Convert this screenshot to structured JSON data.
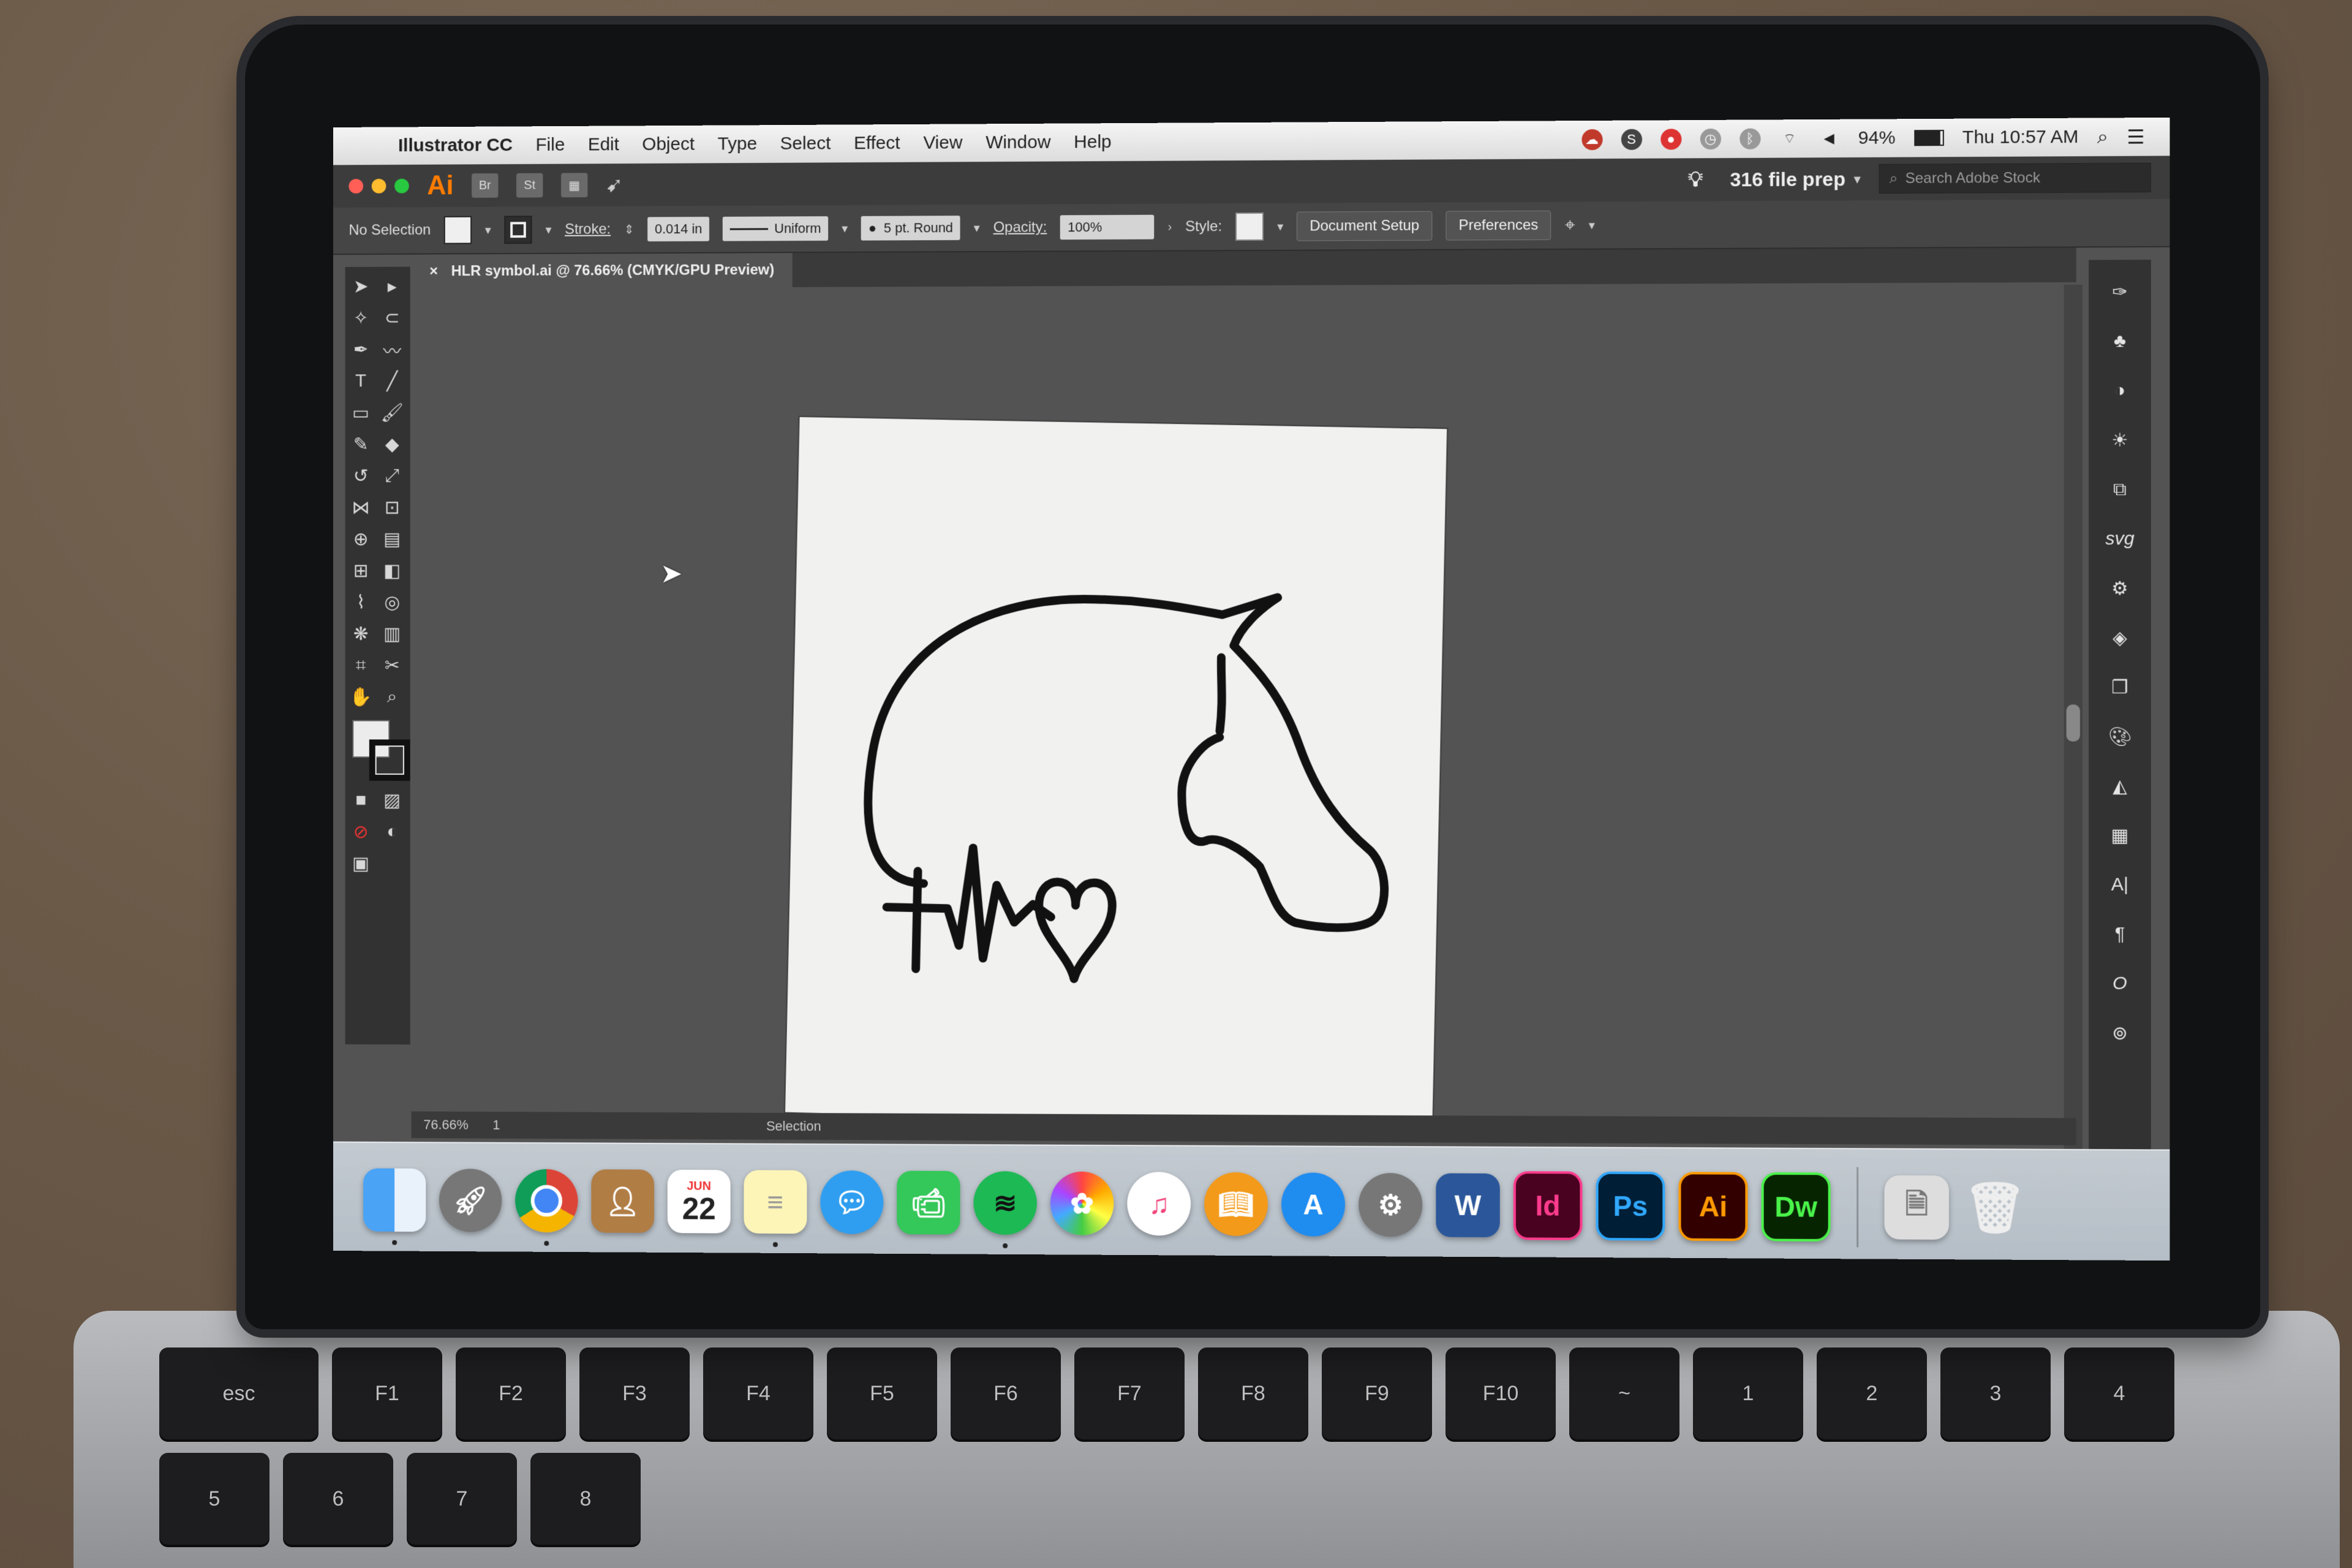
{
  "menubar": {
    "app_name": "Illustrator CC",
    "items": [
      "File",
      "Edit",
      "Object",
      "Type",
      "Select",
      "Effect",
      "View",
      "Window",
      "Help"
    ],
    "battery": "94%",
    "clock": "Thu 10:57 AM"
  },
  "appbar": {
    "logo": "Ai",
    "bridge": "Br",
    "stock": "St",
    "workspace": "316 file prep",
    "search_placeholder": "Search Adobe Stock"
  },
  "control_bar": {
    "selection": "No Selection",
    "stroke_label": "Stroke:",
    "stroke_value": "0.014 in",
    "profile": "Uniform",
    "brush": "5 pt. Round",
    "opacity_label": "Opacity:",
    "opacity_value": "100%",
    "style_label": "Style:",
    "document_setup": "Document Setup",
    "preferences": "Preferences"
  },
  "document_tab": {
    "close": "×",
    "title": "HLR symbol.ai @ 76.66% (CMYK/GPU Preview)"
  },
  "status": {
    "zoom": "76.66%",
    "artboard": "1",
    "mode": "Selection"
  },
  "right_panel_labels": {
    "svg": "svg",
    "type": "A|",
    "paragraph": "¶",
    "glyph": "O"
  },
  "dock": {
    "calendar_month": "JUN",
    "calendar_day": "22",
    "indesign": "Id",
    "photoshop": "Ps",
    "illustrator": "Ai",
    "dreamweaver": "Dw",
    "word": "W"
  },
  "keyboard": [
    "esc",
    "F1",
    "F2",
    "F3",
    "F4",
    "F5",
    "F6",
    "F7",
    "F8",
    "F9",
    "F10",
    "~",
    "1",
    "2",
    "3",
    "4",
    "5",
    "6",
    "7",
    "8"
  ],
  "colors": {
    "ui_dark": "#323232",
    "canvas": "#535353",
    "illustrator_orange": "#ff7c00",
    "indesign_pink": "#ff3b8d",
    "photoshop_blue": "#31a8ff",
    "dreamweaver_green": "#4af34a"
  }
}
